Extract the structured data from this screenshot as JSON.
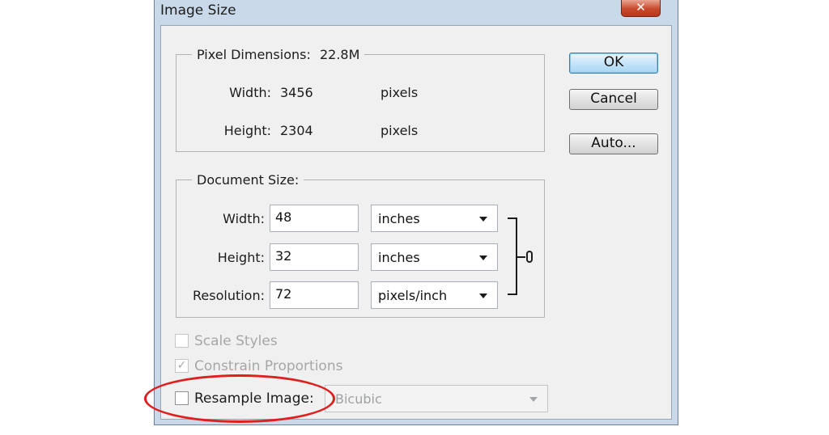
{
  "window": {
    "title": "Image Size",
    "close_glyph": "✕"
  },
  "pixel_dimensions": {
    "legend": "Pixel Dimensions:",
    "size": "22.8M",
    "width_label": "Width:",
    "width_value": "3456",
    "width_unit": "pixels",
    "height_label": "Height:",
    "height_value": "2304",
    "height_unit": "pixels"
  },
  "document_size": {
    "legend": "Document Size:",
    "width_label": "Width:",
    "width_value": "48",
    "width_unit": "inches",
    "height_label": "Height:",
    "height_value": "32",
    "height_unit": "inches",
    "resolution_label": "Resolution:",
    "resolution_value": "72",
    "resolution_unit": "pixels/inch"
  },
  "buttons": {
    "ok": "OK",
    "cancel": "Cancel",
    "auto": "Auto..."
  },
  "options": {
    "scale_styles": "Scale Styles",
    "constrain_proportions": "Constrain Proportions",
    "constrain_checkmark": "✓",
    "resample_image": "Resample Image:",
    "resample_method": "Bicubic"
  },
  "colors": {
    "highlight": "#e01e1e",
    "default_button": "#3c7fb1"
  }
}
